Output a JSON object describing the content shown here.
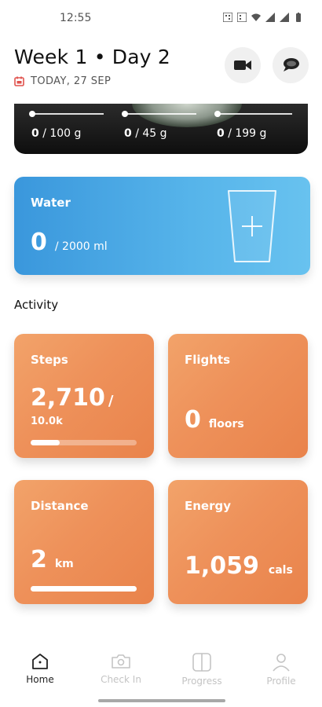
{
  "status_bar": {
    "time": "12:55"
  },
  "header": {
    "title": "Week 1 • Day 2",
    "date": "TODAY, 27 SEP",
    "video_icon": "video-camera-icon",
    "chat_icon": "chat-bubbles-icon"
  },
  "macros": [
    {
      "value": "0",
      "goal": "/ 100 g",
      "progress": 0
    },
    {
      "value": "0",
      "goal": "/ 45 g",
      "progress": 0
    },
    {
      "value": "0",
      "goal": "/ 199 g",
      "progress": 0
    }
  ],
  "water": {
    "label": "Water",
    "amount": "0",
    "goal": "/ 2000 ml",
    "progress": 0,
    "icon": "add-water-glass-icon",
    "colors": {
      "start": "#3a97dc",
      "end": "#68c2ef"
    }
  },
  "activity": {
    "heading": "Activity",
    "accent": "#ee915a",
    "steps": {
      "label": "Steps",
      "value": "2,710",
      "separator": "/",
      "goal": "10.0k",
      "progress": 0.271
    },
    "flights": {
      "label": "Flights",
      "value": "0",
      "unit": "floors"
    },
    "distance": {
      "label": "Distance",
      "value": "2",
      "unit": "km",
      "progress": 1.0
    },
    "energy": {
      "label": "Energy",
      "value": "1,059",
      "unit": "cals"
    }
  },
  "nav": {
    "items": [
      {
        "label": "Home",
        "icon": "home-icon",
        "active": true
      },
      {
        "label": "Check In",
        "icon": "camera-icon",
        "active": false
      },
      {
        "label": "Progress",
        "icon": "compare-icon",
        "active": false
      },
      {
        "label": "Profile",
        "icon": "person-icon",
        "active": false
      }
    ]
  }
}
